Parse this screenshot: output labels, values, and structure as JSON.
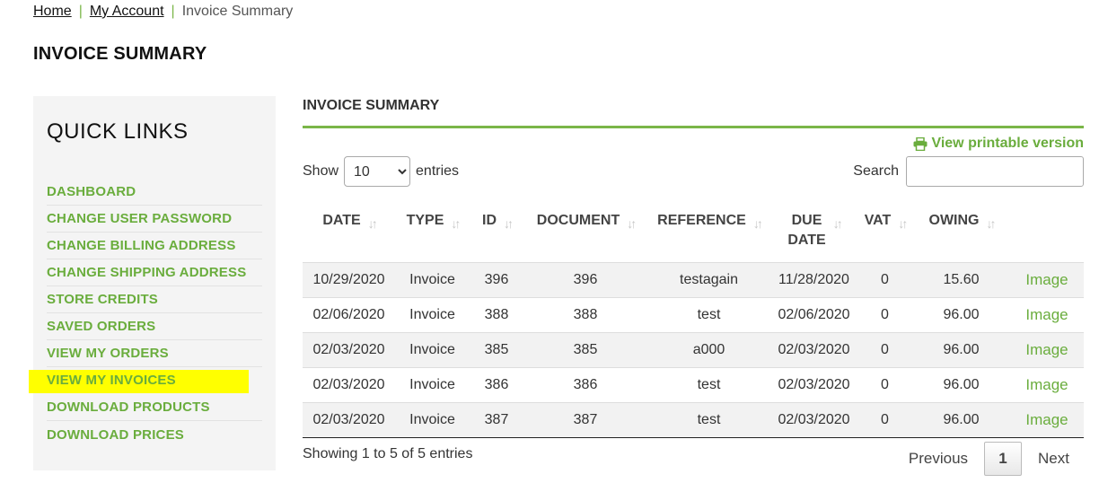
{
  "breadcrumb": {
    "home": "Home",
    "account": "My Account",
    "current": "Invoice Summary",
    "separator": "|"
  },
  "page_title": "INVOICE SUMMARY",
  "sidebar": {
    "title": "QUICK LINKS",
    "items": [
      {
        "label": "DASHBOARD"
      },
      {
        "label": "CHANGE USER PASSWORD"
      },
      {
        "label": "CHANGE BILLING ADDRESS"
      },
      {
        "label": "CHANGE SHIPPING ADDRESS"
      },
      {
        "label": "STORE CREDITS"
      },
      {
        "label": "SAVED ORDERS"
      },
      {
        "label": "VIEW MY ORDERS"
      },
      {
        "label": "VIEW MY INVOICES",
        "active": true
      },
      {
        "label": "DOWNLOAD PRODUCTS"
      },
      {
        "label": "DOWNLOAD PRICES"
      }
    ]
  },
  "main": {
    "section_title": "INVOICE SUMMARY",
    "printable_label": "View printable version",
    "printable_icon": "printer-icon",
    "show_label": "Show",
    "entries_value": "10",
    "entries_label": "entries",
    "search_label": "Search",
    "search_value": ""
  },
  "table": {
    "headers": {
      "date": "DATE",
      "type": "TYPE",
      "id": "ID",
      "document": "DOCUMENT",
      "reference": "REFERENCE",
      "due_line1": "DUE",
      "due_line2": "DATE",
      "vat": "VAT",
      "owing": "OWING"
    },
    "sort_icon": "sort-arrows-icon",
    "rows": [
      {
        "date": "10/29/2020",
        "type": "Invoice",
        "id": "396",
        "document": "396",
        "reference": "testagain",
        "due": "11/28/2020",
        "vat": "0",
        "owing": "15.60",
        "link": "Image"
      },
      {
        "date": "02/06/2020",
        "type": "Invoice",
        "id": "388",
        "document": "388",
        "reference": "test",
        "due": "02/06/2020",
        "vat": "0",
        "owing": "96.00",
        "link": "Image"
      },
      {
        "date": "02/03/2020",
        "type": "Invoice",
        "id": "385",
        "document": "385",
        "reference": "a000",
        "due": "02/03/2020",
        "vat": "0",
        "owing": "96.00",
        "link": "Image"
      },
      {
        "date": "02/03/2020",
        "type": "Invoice",
        "id": "386",
        "document": "386",
        "reference": "test",
        "due": "02/03/2020",
        "vat": "0",
        "owing": "96.00",
        "link": "Image"
      },
      {
        "date": "02/03/2020",
        "type": "Invoice",
        "id": "387",
        "document": "387",
        "reference": "test",
        "due": "02/03/2020",
        "vat": "0",
        "owing": "96.00",
        "link": "Image"
      }
    ]
  },
  "footer": {
    "info": "Showing 1 to 5 of 5 entries",
    "previous": "Previous",
    "page": "1",
    "next": "Next"
  },
  "colors": {
    "accent": "#6aad3d",
    "highlight": "#ffff00"
  }
}
